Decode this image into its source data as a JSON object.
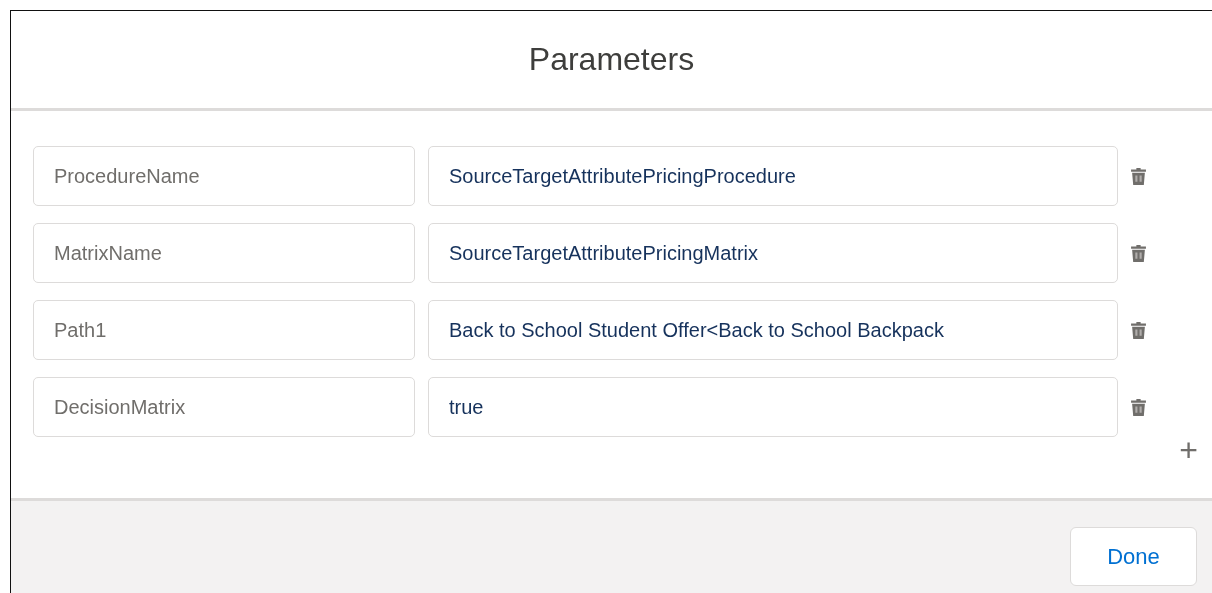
{
  "modal": {
    "title": "Parameters"
  },
  "parameters": [
    {
      "key": "ProcedureName",
      "value": "SourceTargetAttributePricingProcedure"
    },
    {
      "key": "MatrixName",
      "value": "SourceTargetAttributePricingMatrix"
    },
    {
      "key": "Path1",
      "value": "Back to School Student Offer<Back to School Backpack"
    },
    {
      "key": "DecisionMatrix",
      "value": "true"
    }
  ],
  "add_button": {
    "label": "+"
  },
  "footer": {
    "buttons": [
      {
        "label": "Done"
      }
    ]
  }
}
